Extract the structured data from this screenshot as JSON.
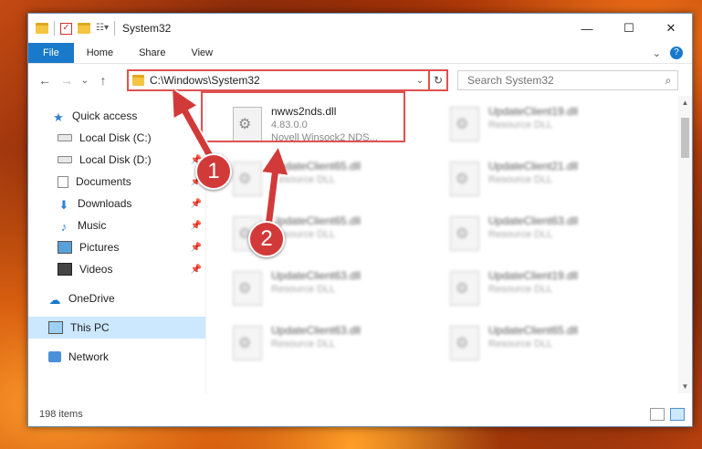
{
  "window": {
    "title": "System32",
    "controls": {
      "minimize": "—",
      "maximize": "☐",
      "close": "✕"
    }
  },
  "ribbon": {
    "tabs": [
      {
        "label": "File"
      },
      {
        "label": "Home"
      },
      {
        "label": "Share"
      },
      {
        "label": "View"
      }
    ],
    "expand": "⌄",
    "help": "?"
  },
  "navigation": {
    "back": "←",
    "forward": "→",
    "recent": "⌄",
    "up": "↑",
    "address": "C:\\Windows\\System32",
    "address_dropdown": "⌄",
    "refresh": "↻",
    "search_placeholder": "Search System32",
    "search_icon": "⌕"
  },
  "sidebar": {
    "items": [
      {
        "label": "Quick access",
        "icon": "star-icon"
      },
      {
        "label": "Local Disk (C:)",
        "icon": "disk-icon"
      },
      {
        "label": "Local Disk (D:)",
        "icon": "disk-icon",
        "pinned": true
      },
      {
        "label": "Documents",
        "icon": "documents-icon",
        "pinned": true
      },
      {
        "label": "Downloads",
        "icon": "downloads-icon",
        "pinned": true
      },
      {
        "label": "Music",
        "icon": "music-icon",
        "pinned": true
      },
      {
        "label": "Pictures",
        "icon": "pictures-icon",
        "pinned": true
      },
      {
        "label": "Videos",
        "icon": "videos-icon",
        "pinned": true
      },
      {
        "label": "OneDrive",
        "icon": "onedrive-icon"
      },
      {
        "label": "This PC",
        "icon": "this-pc-icon",
        "selected": true
      },
      {
        "label": "Network",
        "icon": "network-icon"
      }
    ],
    "pin_glyph": "📌"
  },
  "files": [
    {
      "name": "nwws2nds.dll",
      "line2": "4.83.0.0",
      "line3": "Novell Winsock2 NDS...",
      "highlighted": true
    },
    {
      "name": "UpdateClient19.dll",
      "line2": "Resource DLL"
    },
    {
      "name": "UpdateClient65.dll",
      "line2": "Resource DLL"
    },
    {
      "name": "UpdateClient21.dll",
      "line2": "Resource DLL"
    },
    {
      "name": "UpdateClient65.dll",
      "line2": "Resource DLL"
    },
    {
      "name": "UpdateClient63.dll",
      "line2": "Resource DLL"
    },
    {
      "name": "UpdateClient63.dll",
      "line2": "Resource DLL"
    },
    {
      "name": "UpdateClient19.dll",
      "line2": "Resource DLL"
    },
    {
      "name": "UpdateClient63.dll",
      "line2": "Resource DLL"
    },
    {
      "name": "UpdateClient65.dll",
      "line2": "Resource DLL"
    }
  ],
  "status": {
    "item_count": "198 items"
  },
  "annotations": {
    "badge1": "1",
    "badge2": "2"
  },
  "colors": {
    "accent": "#1979ca",
    "highlight_border": "#e05050",
    "badge": "#d23a3a"
  }
}
